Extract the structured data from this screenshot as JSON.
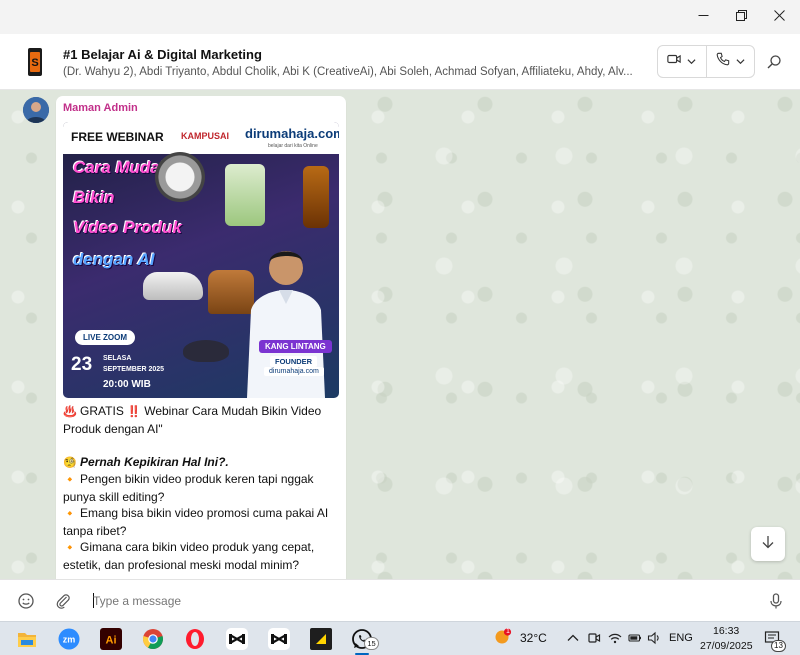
{
  "window": {
    "minimize_icon": "minimize-icon",
    "maximize_icon": "restore-icon",
    "close_icon": "close-icon"
  },
  "header": {
    "title": "#1 Belajar Ai & Digital Marketing",
    "members": "(Dr. Wahyu 2), Abdi Triyanto, Abdul Cholik, Abi K (CreativeAi), Abi Soleh, Achmad Sofyan, Affiliateku, Ahdy, Alv...",
    "video_icon": "video-camera-icon",
    "call_icon": "phone-icon",
    "search_icon": "search-icon"
  },
  "message": {
    "sender": "Maman Admin",
    "poster": {
      "free_webinar": "FREE WEBINAR",
      "brand_a": "KAMPUSAI",
      "brand_b": "dirumahaja.com",
      "brand_b_sub": "belajar dari kita Online",
      "headline": [
        "Cara Mudah",
        "Bikin",
        "Video Produk",
        "dengan AI"
      ],
      "live": "LIVE ZOOM",
      "day": "23",
      "weekday": "SELASA",
      "month_year": "SEPTEMBER 2025",
      "time": "20:00 WIB",
      "speaker": "KANG LINTANG",
      "role": "FOUNDER",
      "site": "dirumahaja.com"
    },
    "lines": [
      {
        "emoji": "♨️",
        "text": "GRATIS",
        "emoji2": "‼️",
        "rest": "Webinar Cara Mudah Bikin Video Produk dengan AI\""
      },
      {
        "emoji": "🧐",
        "text": "Pernah Kepikiran Hal Ini?."
      },
      {
        "emoji": "🔸",
        "text": "Pengen bikin video produk keren tapi nggak punya skill editing?"
      },
      {
        "emoji": "🔸",
        "text": "Emang bisa bikin video promosi cuma pakai AI tanpa ribet?"
      },
      {
        "emoji": "🔸",
        "text": "Gimana cara bikin video produk yang cepat, estetik, dan profesional meski modal minim?"
      }
    ]
  },
  "composer": {
    "placeholder": "Type a message",
    "emoji_icon": "smiley-icon",
    "attach_icon": "paperclip-icon",
    "mic_icon": "microphone-icon"
  },
  "taskbar": {
    "apps": [
      "file-explorer-icon",
      "zoom-icon",
      "illustrator-icon",
      "chrome-icon",
      "opera-icon",
      "capcut-icon",
      "capcut-icon-2",
      "sticky-app-icon",
      "whatsapp-icon"
    ],
    "whatsapp_badge": "15",
    "weather_temp": "32°C",
    "weather_badge": "1",
    "language": "ENG",
    "time": "16:33",
    "date": "27/09/2025",
    "notifications": "13"
  },
  "colors": {
    "sender_name": "#c2308a",
    "chat_bg": "#dfe6dc",
    "accent": "#0067c0"
  }
}
